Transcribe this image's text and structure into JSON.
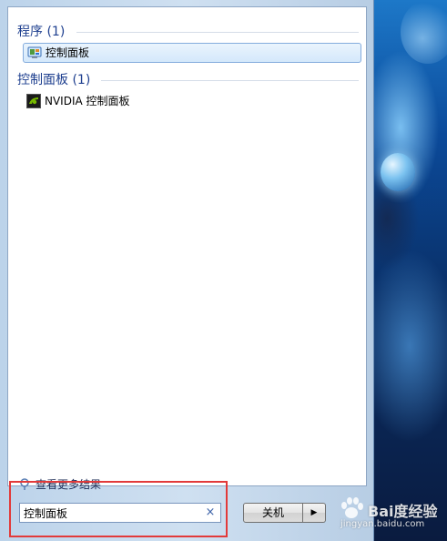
{
  "results": {
    "programs": {
      "header": "程序 (1)",
      "items": [
        {
          "label": "控制面板",
          "icon": "control-panel-icon",
          "selected": true
        }
      ]
    },
    "control_panel": {
      "header": "控制面板 (1)",
      "items": [
        {
          "label": "NVIDIA 控制面板",
          "icon": "nvidia-icon",
          "selected": false
        }
      ]
    },
    "see_more": "查看更多结果"
  },
  "search": {
    "value": "控制面板",
    "clear_glyph": "×"
  },
  "shutdown": {
    "label": "关机",
    "arrow": "▶"
  },
  "watermark": {
    "brand": "Bai度经验",
    "url": "jingyan.baidu.com"
  },
  "colors": {
    "header_text": "#1e3f8f",
    "highlight_outline": "#e23a3a",
    "selection_border": "#84acdd"
  }
}
